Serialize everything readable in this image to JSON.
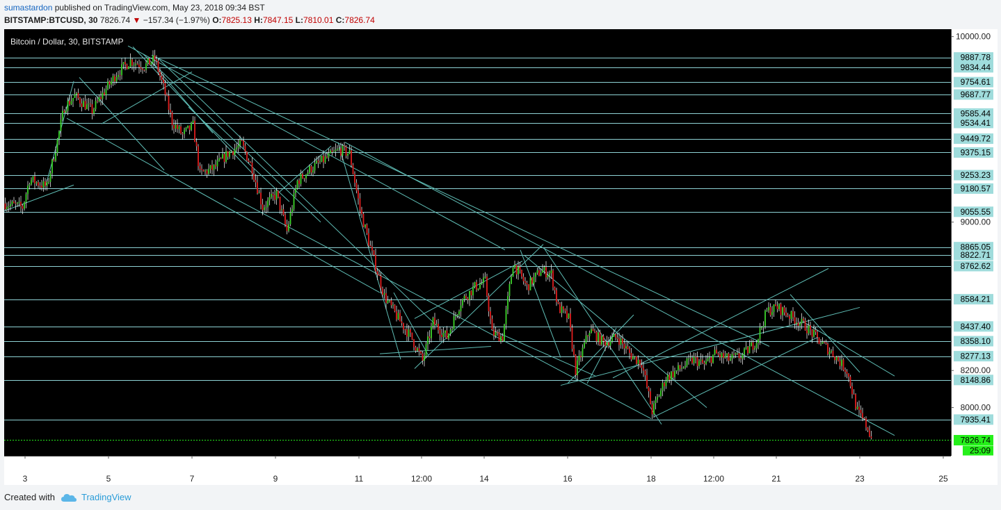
{
  "header": {
    "author": "sumastardon",
    "published": "published on TradingView.com, May 23, 2018 09:34 BST",
    "symbol": "BITSTAMP:BTCUSD, 30",
    "last": "7826.74",
    "change": "−157.34 (−1.97%)",
    "o_label": "O:",
    "o_value": "7825.13",
    "h_label": "H:",
    "h_value": "7847.15",
    "l_label": "L:",
    "l_value": "7810.01",
    "c_label": "C:",
    "c_value": "7826.74"
  },
  "footer": {
    "created_with": "Created with",
    "brand": "TradingView"
  },
  "colors": {
    "background": "#000000",
    "hline": "#8fd3d6",
    "trendline": "#5fbdb5",
    "label_bg": "#9fdcdc",
    "last_price": "#25f01a",
    "candle_up": "#3cd42a",
    "candle_down": "#e01e1e",
    "candle_wick": "#e8e8e8"
  },
  "chart_data": {
    "type": "candlestick",
    "title": "Bitcoin / Dollar, 30, BITSTAMP",
    "ylim": [
      7740,
      10040
    ],
    "y_ticks": [
      "10000.00",
      "9000.00",
      "8200.00",
      "8000.00"
    ],
    "x_ticks": [
      "3",
      "5",
      "7",
      "9",
      "11",
      "12:00",
      "14",
      "16",
      "18",
      "12:00",
      "21",
      "23",
      "25"
    ],
    "x_tick_index": [
      30,
      150,
      270,
      390,
      510,
      600,
      690,
      810,
      930,
      1020,
      1110,
      1230,
      1350
    ],
    "horizontal_levels": [
      "9887.78",
      "9834.44",
      "9754.61",
      "9687.77",
      "9585.44",
      "9534.41",
      "9449.72",
      "9375.15",
      "9253.23",
      "9180.57",
      "9055.55",
      "8865.05",
      "8822.71",
      "8762.62",
      "8584.21",
      "8437.40",
      "8358.10",
      "8277.13",
      "8148.86",
      "7935.41"
    ],
    "last_price": "7826.74",
    "countdown": "25:09",
    "price_path": [
      [
        0,
        9100
      ],
      [
        25,
        9080
      ],
      [
        35,
        9230
      ],
      [
        60,
        9190
      ],
      [
        75,
        9440
      ],
      [
        85,
        9620
      ],
      [
        100,
        9680
      ],
      [
        125,
        9600
      ],
      [
        140,
        9690
      ],
      [
        160,
        9800
      ],
      [
        180,
        9870
      ],
      [
        200,
        9840
      ],
      [
        215,
        9880
      ],
      [
        228,
        9720
      ],
      [
        240,
        9540
      ],
      [
        255,
        9470
      ],
      [
        270,
        9520
      ],
      [
        280,
        9260
      ],
      [
        300,
        9290
      ],
      [
        320,
        9370
      ],
      [
        340,
        9420
      ],
      [
        355,
        9290
      ],
      [
        370,
        9080
      ],
      [
        390,
        9150
      ],
      [
        405,
        8950
      ],
      [
        420,
        9220
      ],
      [
        440,
        9290
      ],
      [
        460,
        9340
      ],
      [
        480,
        9390
      ],
      [
        495,
        9370
      ],
      [
        510,
        9070
      ],
      [
        525,
        8860
      ],
      [
        545,
        8600
      ],
      [
        565,
        8480
      ],
      [
        585,
        8370
      ],
      [
        600,
        8250
      ],
      [
        615,
        8460
      ],
      [
        635,
        8380
      ],
      [
        655,
        8570
      ],
      [
        675,
        8650
      ],
      [
        690,
        8680
      ],
      [
        700,
        8400
      ],
      [
        715,
        8380
      ],
      [
        730,
        8780
      ],
      [
        750,
        8650
      ],
      [
        770,
        8740
      ],
      [
        785,
        8720
      ],
      [
        795,
        8540
      ],
      [
        810,
        8480
      ],
      [
        820,
        8200
      ],
      [
        840,
        8420
      ],
      [
        860,
        8350
      ],
      [
        880,
        8380
      ],
      [
        900,
        8280
      ],
      [
        915,
        8240
      ],
      [
        930,
        7980
      ],
      [
        950,
        8160
      ],
      [
        970,
        8210
      ],
      [
        990,
        8260
      ],
      [
        1005,
        8230
      ],
      [
        1020,
        8290
      ],
      [
        1040,
        8260
      ],
      [
        1060,
        8280
      ],
      [
        1080,
        8360
      ],
      [
        1095,
        8520
      ],
      [
        1110,
        8540
      ],
      [
        1130,
        8490
      ],
      [
        1150,
        8440
      ],
      [
        1170,
        8360
      ],
      [
        1190,
        8290
      ],
      [
        1210,
        8200
      ],
      [
        1225,
        7980
      ],
      [
        1240,
        7890
      ],
      [
        1246,
        7826
      ]
    ],
    "trendlines": [
      [
        [
          0,
          9060
        ],
        [
          100,
          9200
        ]
      ],
      [
        [
          60,
          9200
        ],
        [
          100,
          9760
        ]
      ],
      [
        [
          90,
          9560
        ],
        [
          540,
          8620
        ]
      ],
      [
        [
          108,
          9780
        ],
        [
          230,
          9280
        ]
      ],
      [
        [
          140,
          9530
        ],
        [
          270,
          9810
        ]
      ],
      [
        [
          178,
          9950
        ],
        [
          720,
          8850
        ]
      ],
      [
        [
          185,
          9945
        ],
        [
          360,
          9250
        ]
      ],
      [
        [
          200,
          9905
        ],
        [
          455,
          9000
        ]
      ],
      [
        [
          212,
          9900
        ],
        [
          1100,
          8330
        ]
      ],
      [
        [
          222,
          9880
        ],
        [
          625,
          8430
        ]
      ],
      [
        [
          210,
          9870
        ],
        [
          300,
          9480
        ]
      ],
      [
        [
          265,
          9620
        ],
        [
          410,
          9110
        ]
      ],
      [
        [
          395,
          9160
        ],
        [
          470,
          9410
        ]
      ],
      [
        [
          330,
          9130
        ],
        [
          930,
          7940
        ]
      ],
      [
        [
          480,
          9430
        ],
        [
          570,
          8260
        ]
      ],
      [
        [
          490,
          9430
        ],
        [
          1280,
          7850
        ]
      ],
      [
        [
          540,
          8290
        ],
        [
          700,
          8330
        ]
      ],
      [
        [
          560,
          8620
        ],
        [
          610,
          8280
        ]
      ],
      [
        [
          590,
          8210
        ],
        [
          775,
          8880
        ]
      ],
      [
        [
          590,
          8480
        ],
        [
          745,
          8790
        ]
      ],
      [
        [
          700,
          8420
        ],
        [
          850,
          8170
        ]
      ],
      [
        [
          742,
          8850
        ],
        [
          800,
          8270
        ]
      ],
      [
        [
          748,
          8820
        ],
        [
          1010,
          8000
        ]
      ],
      [
        [
          776,
          8860
        ],
        [
          945,
          7910
        ]
      ],
      [
        [
          800,
          8120
        ],
        [
          1230,
          8540
        ]
      ],
      [
        [
          810,
          8130
        ],
        [
          905,
          8500
        ]
      ],
      [
        [
          838,
          8130
        ],
        [
          880,
          8430
        ]
      ],
      [
        [
          875,
          8160
        ],
        [
          1185,
          8750
        ]
      ],
      [
        [
          934,
          7950
        ],
        [
          1170,
          8380
        ]
      ],
      [
        [
          1130,
          8610
        ],
        [
          1230,
          8190
        ]
      ],
      [
        [
          1150,
          8460
        ],
        [
          1280,
          8170
        ]
      ]
    ]
  }
}
